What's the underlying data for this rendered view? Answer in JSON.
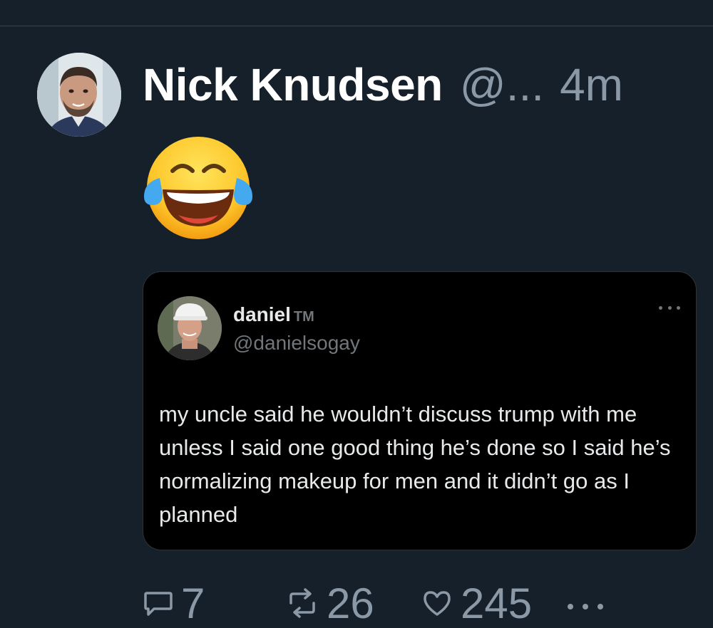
{
  "post": {
    "author_name": "Nick Knudsen",
    "author_handle": "@...",
    "time": "4m",
    "body_emoji": "face-with-tears-of-joy"
  },
  "quoted": {
    "name": "daniel",
    "name_suffix": "TM",
    "handle": "@danielsogay",
    "text": "my uncle said he wouldn’t discuss trump with me unless I said one good thing he’s done so I said he’s normalizing makeup for men and it didn’t go as I planned"
  },
  "actions": {
    "replies": "7",
    "reposts": "26",
    "likes": "245"
  },
  "colors": {
    "background": "#15202b",
    "muted_text": "#8b98a5",
    "card_background": "#000000"
  }
}
